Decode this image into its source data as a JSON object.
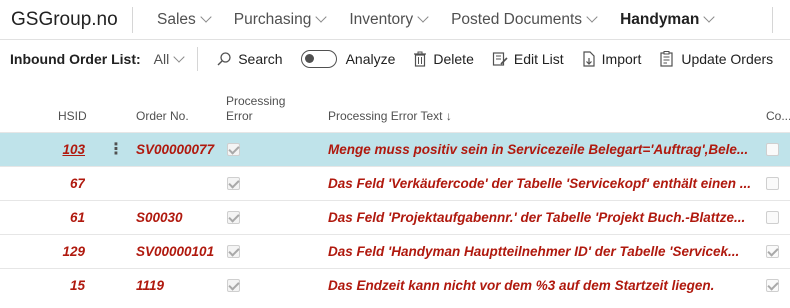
{
  "app": {
    "company": "GSGroup.no",
    "nav": [
      "Sales",
      "Purchasing",
      "Inventory",
      "Posted Documents",
      "Handyman"
    ],
    "active_nav": "Handyman"
  },
  "actionbar": {
    "title": "Inbound Order List:",
    "filter": "All",
    "actions": {
      "search": "Search",
      "analyze": "Analyze",
      "delete": "Delete",
      "edit_list": "Edit List",
      "import": "Import",
      "update_orders": "Update Orders"
    }
  },
  "columns": {
    "hsid": "HSID",
    "order_no": "Order No.",
    "processing_error_1": "Processing",
    "processing_error_2": "Error",
    "error_text": "Processing Error Text ↓",
    "co": "Co..."
  },
  "rows": [
    {
      "hsid": "103",
      "order_no": "SV00000077",
      "processing_error": true,
      "error_text": "Menge muss positiv sein in Servicezeile Belegart='Auftrag',Bele...",
      "co": false,
      "selected": true
    },
    {
      "hsid": "67",
      "order_no": "",
      "processing_error": true,
      "error_text": "Das Feld 'Verkäufercode' der Tabelle 'Servicekopf' enthält einen ...",
      "co": false,
      "selected": false
    },
    {
      "hsid": "61",
      "order_no": "S00030",
      "processing_error": true,
      "error_text": "Das Feld 'Projektaufgabennr.' der Tabelle 'Projekt Buch.-Blattze...",
      "co": false,
      "selected": false
    },
    {
      "hsid": "129",
      "order_no": "SV00000101",
      "processing_error": true,
      "error_text": "Das Feld 'Handyman Hauptteilnehmer ID' der Tabelle 'Servicek...",
      "co": true,
      "selected": false
    },
    {
      "hsid": "15",
      "order_no": "1119",
      "processing_error": true,
      "error_text": "Das Endzeit kann nicht vor dem %3 auf dem Startzeit liegen.",
      "co": true,
      "selected": false
    }
  ],
  "colors": {
    "error_text": "#b0190e",
    "selected_row": "#bfe3ea"
  }
}
